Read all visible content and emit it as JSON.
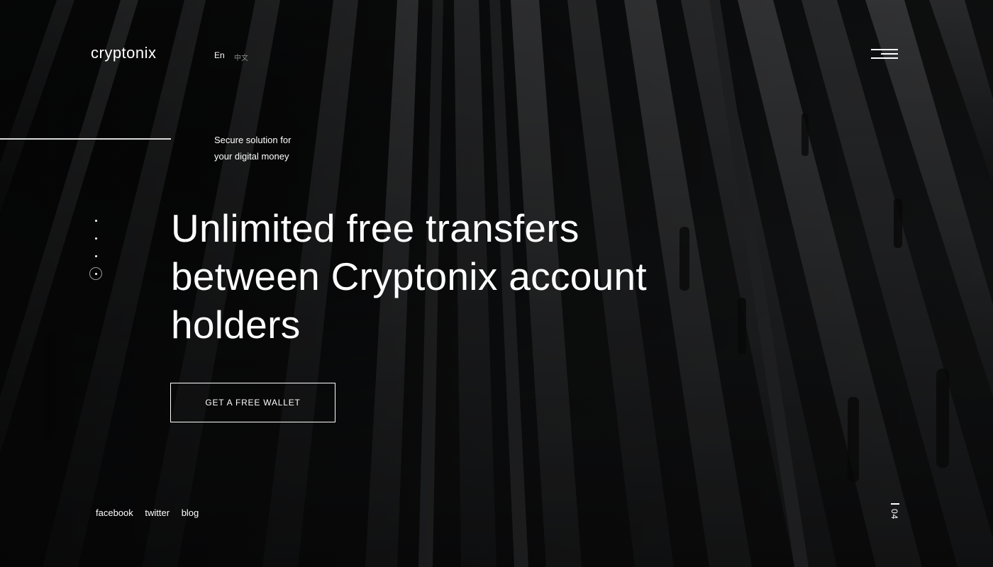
{
  "brand": {
    "logo": "cryptonix"
  },
  "language": {
    "en": "En",
    "zh": "中文"
  },
  "menu": {
    "icon": "hamburger-menu-icon"
  },
  "hero": {
    "tagline": [
      "Secure solution for",
      "your digital money"
    ],
    "headline": [
      "Unlimited free transfers",
      "between Cryptonix account",
      "holders"
    ],
    "cta_label": "GET A FREE WALLET",
    "slides_total": 4,
    "slides_active": 4
  },
  "social": {
    "facebook": "facebook",
    "twitter": "twitter",
    "blog": "blog"
  },
  "page_indicator": {
    "number": "04"
  },
  "colors": {
    "background": "#0d0d0e",
    "text": "#ffffff",
    "muted": "#8b8b8b"
  }
}
